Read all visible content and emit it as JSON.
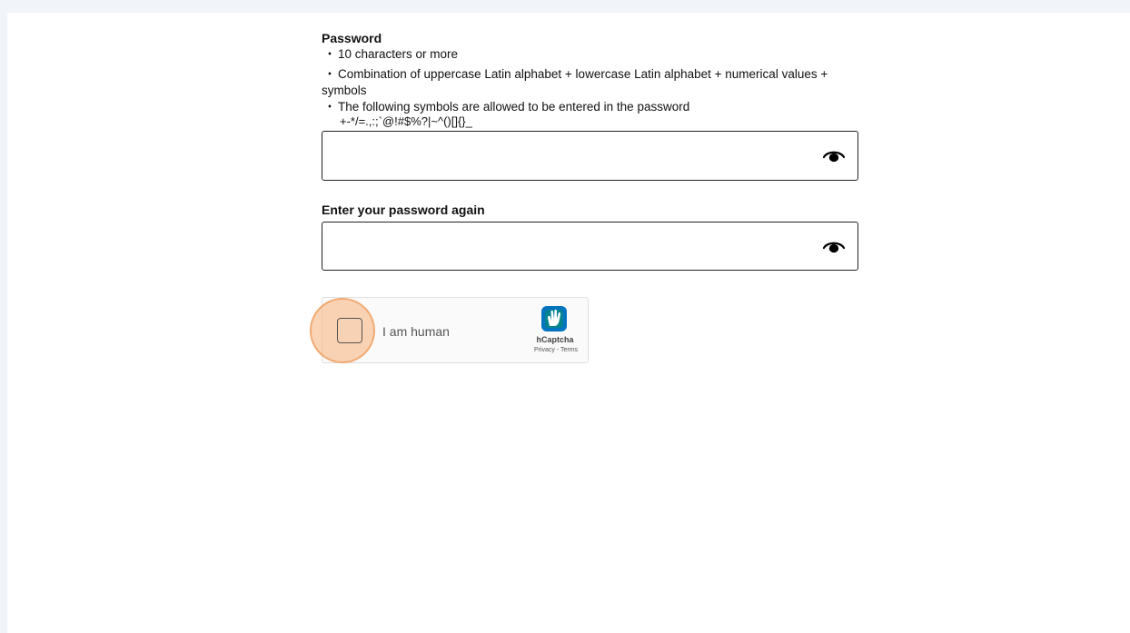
{
  "password": {
    "label": "Password",
    "rules": [
      "10 characters or more",
      "Combination of uppercase Latin alphabet + lowercase Latin alphabet + numerical values + symbols",
      "The following symbols are allowed to be entered in the password"
    ],
    "bullet": "・",
    "symbols": "+-*/=.,:;`@!#$%?|~^()[]{}_",
    "value": "",
    "icon": "eye-icon"
  },
  "confirm": {
    "label": "Enter your password again",
    "value": "",
    "icon": "eye-icon"
  },
  "captcha": {
    "label": "I am human",
    "brand": "hCaptcha",
    "privacy": "Privacy",
    "separator": " - ",
    "terms": "Terms",
    "checked": false
  },
  "colors": {
    "background": "#f1f4f8",
    "highlight": "#f6b079",
    "hcaptcha_teal": "#00838f"
  }
}
